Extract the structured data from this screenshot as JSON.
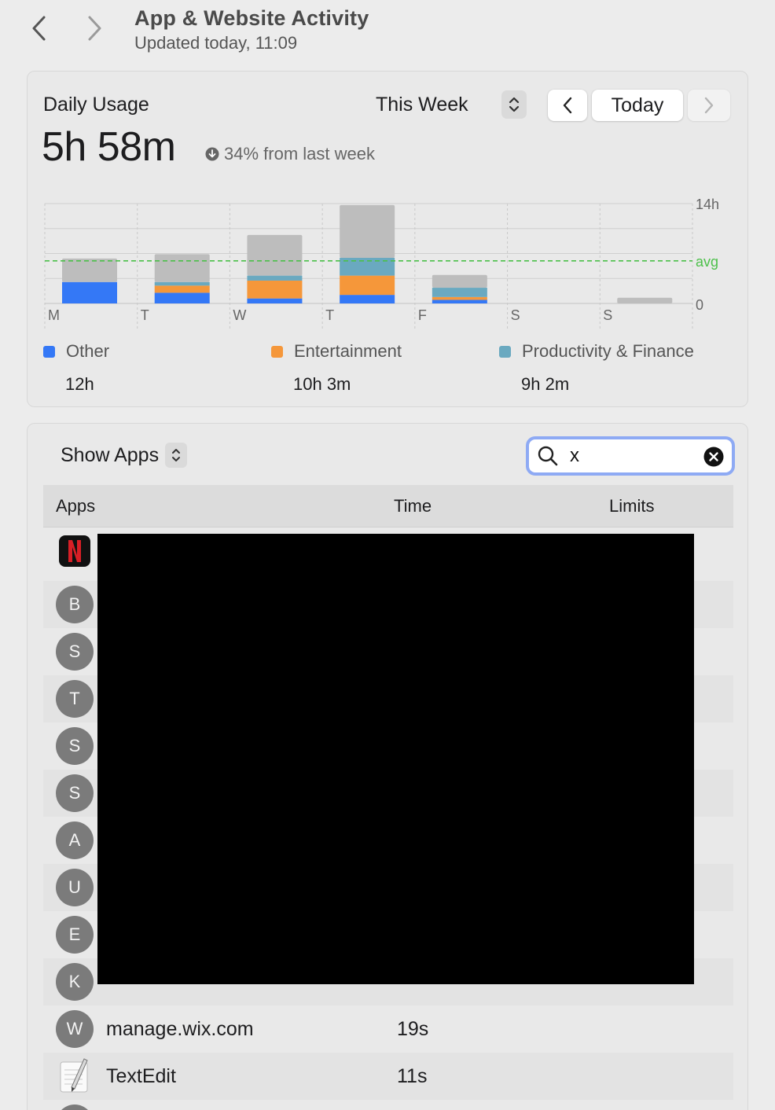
{
  "header": {
    "title": "App & Website Activity",
    "subtitle": "Updated today, 11:09",
    "back_icon": "chevron-left-icon",
    "forward_icon": "chevron-right-icon"
  },
  "usage": {
    "label": "Daily Usage",
    "total": "5h 58m",
    "trend": "34% from last week",
    "trend_icon": "arrow-down-circle-icon",
    "period": "This Week",
    "today_label": "Today"
  },
  "chart_data": {
    "type": "bar",
    "stacked": true,
    "categories": [
      "M",
      "T",
      "W",
      "T",
      "F",
      "S",
      "S"
    ],
    "ylim": [
      0,
      14
    ],
    "ytick_labels": [
      "14h",
      "0"
    ],
    "average": 5.97,
    "average_label": "avg",
    "grid": true,
    "colors": {
      "Other": "#3478f6",
      "Entertainment": "#f5973a",
      "Productivity & Finance": "#6aa9c0",
      "uncategorized": "#bdbdbd"
    },
    "series": [
      {
        "name": "Other",
        "values": [
          3.0,
          1.5,
          0.7,
          1.2,
          0.5,
          0,
          0
        ]
      },
      {
        "name": "Entertainment",
        "values": [
          0,
          1.0,
          2.5,
          2.7,
          0.4,
          0,
          0
        ]
      },
      {
        "name": "Productivity & Finance",
        "values": [
          0,
          0.5,
          0.7,
          2.5,
          1.3,
          0,
          0
        ]
      },
      {
        "name": "",
        "values": [
          3.3,
          3.9,
          5.7,
          7.4,
          1.8,
          0,
          0.8
        ]
      }
    ]
  },
  "legend": [
    {
      "name": "Other",
      "value": "12h",
      "color": "#3478f6"
    },
    {
      "name": "Entertainment",
      "value": "10h 3m",
      "color": "#f5973a"
    },
    {
      "name": "Productivity & Finance",
      "value": "9h 2m",
      "color": "#6aa9c0"
    }
  ],
  "apps": {
    "show_label": "Show Apps",
    "search_value": "x",
    "columns": {
      "apps": "Apps",
      "time": "Time",
      "limits": "Limits"
    },
    "rows": [
      {
        "icon": "netflix-icon",
        "letter": ""
      },
      {
        "letter": "B"
      },
      {
        "letter": "S"
      },
      {
        "letter": "T"
      },
      {
        "letter": "S"
      },
      {
        "letter": "S"
      },
      {
        "letter": "A"
      },
      {
        "letter": "U"
      },
      {
        "letter": "E"
      },
      {
        "letter": "K"
      },
      {
        "letter": "W",
        "name": "manage.wix.com",
        "time": "19s"
      },
      {
        "icon": "textedit-icon",
        "name": "TextEdit",
        "time": "11s"
      }
    ]
  }
}
